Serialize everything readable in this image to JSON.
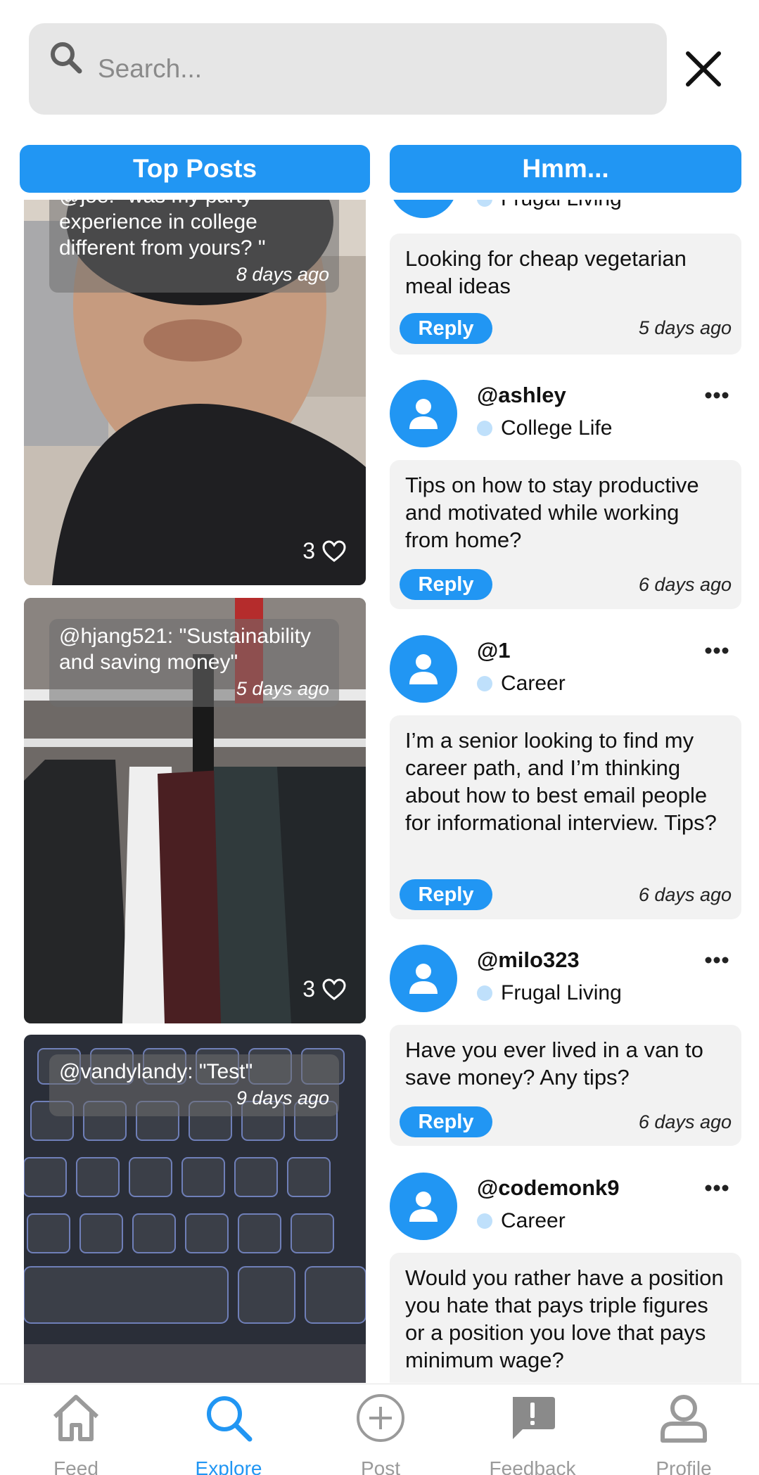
{
  "search": {
    "placeholder": "Search..."
  },
  "columns": {
    "left_title": "Top Posts",
    "right_title": "Hmm..."
  },
  "top_posts": [
    {
      "caption": "@joe: \"was my party experience in college different from yours? \"",
      "time": "8 days ago",
      "likes": "3"
    },
    {
      "caption": "@hjang521: \"Sustainability and saving money\"",
      "time": "5 days ago",
      "likes": "3"
    },
    {
      "caption": "@vandylandy: \"Test\"",
      "time": "9 days ago"
    }
  ],
  "questions": [
    {
      "category": "Frugal Living",
      "text": "Looking for cheap vegetarian meal ideas",
      "reply_label": "Reply",
      "time": "5 days ago"
    },
    {
      "username": "@ashley",
      "category": "College Life",
      "text": "Tips on how to stay productive and motivated while working from home?",
      "reply_label": "Reply",
      "time": "6 days ago"
    },
    {
      "username": "@1",
      "category": "Career",
      "text": "I’m a senior looking to find my career path, and I’m thinking about how to best email people for informational interview. Tips?",
      "reply_label": "Reply",
      "time": "6 days ago"
    },
    {
      "username": "@milo323",
      "category": "Frugal Living",
      "text": "Have you ever lived in a van to save money? Any tips?",
      "reply_label": "Reply",
      "time": "6 days ago"
    },
    {
      "username": "@codemonk9",
      "category": "Career",
      "text": "Would you rather have a position you hate that pays triple figures or a position you love that pays minimum wage?"
    }
  ],
  "nav": {
    "feed": "Feed",
    "explore": "Explore",
    "post": "Post",
    "feedback": "Feedback",
    "profile": "Profile",
    "active": "Explore"
  },
  "colors": {
    "accent": "#2196f3",
    "card_bg": "#f2f2f2",
    "category_dot": "#bfe0fb",
    "inactive": "#9a9a9a"
  },
  "icons": [
    "search-icon",
    "close-icon",
    "heart-icon",
    "user-icon",
    "more-icon",
    "home-icon",
    "feedback-icon",
    "profile-icon",
    "add-post-icon"
  ]
}
